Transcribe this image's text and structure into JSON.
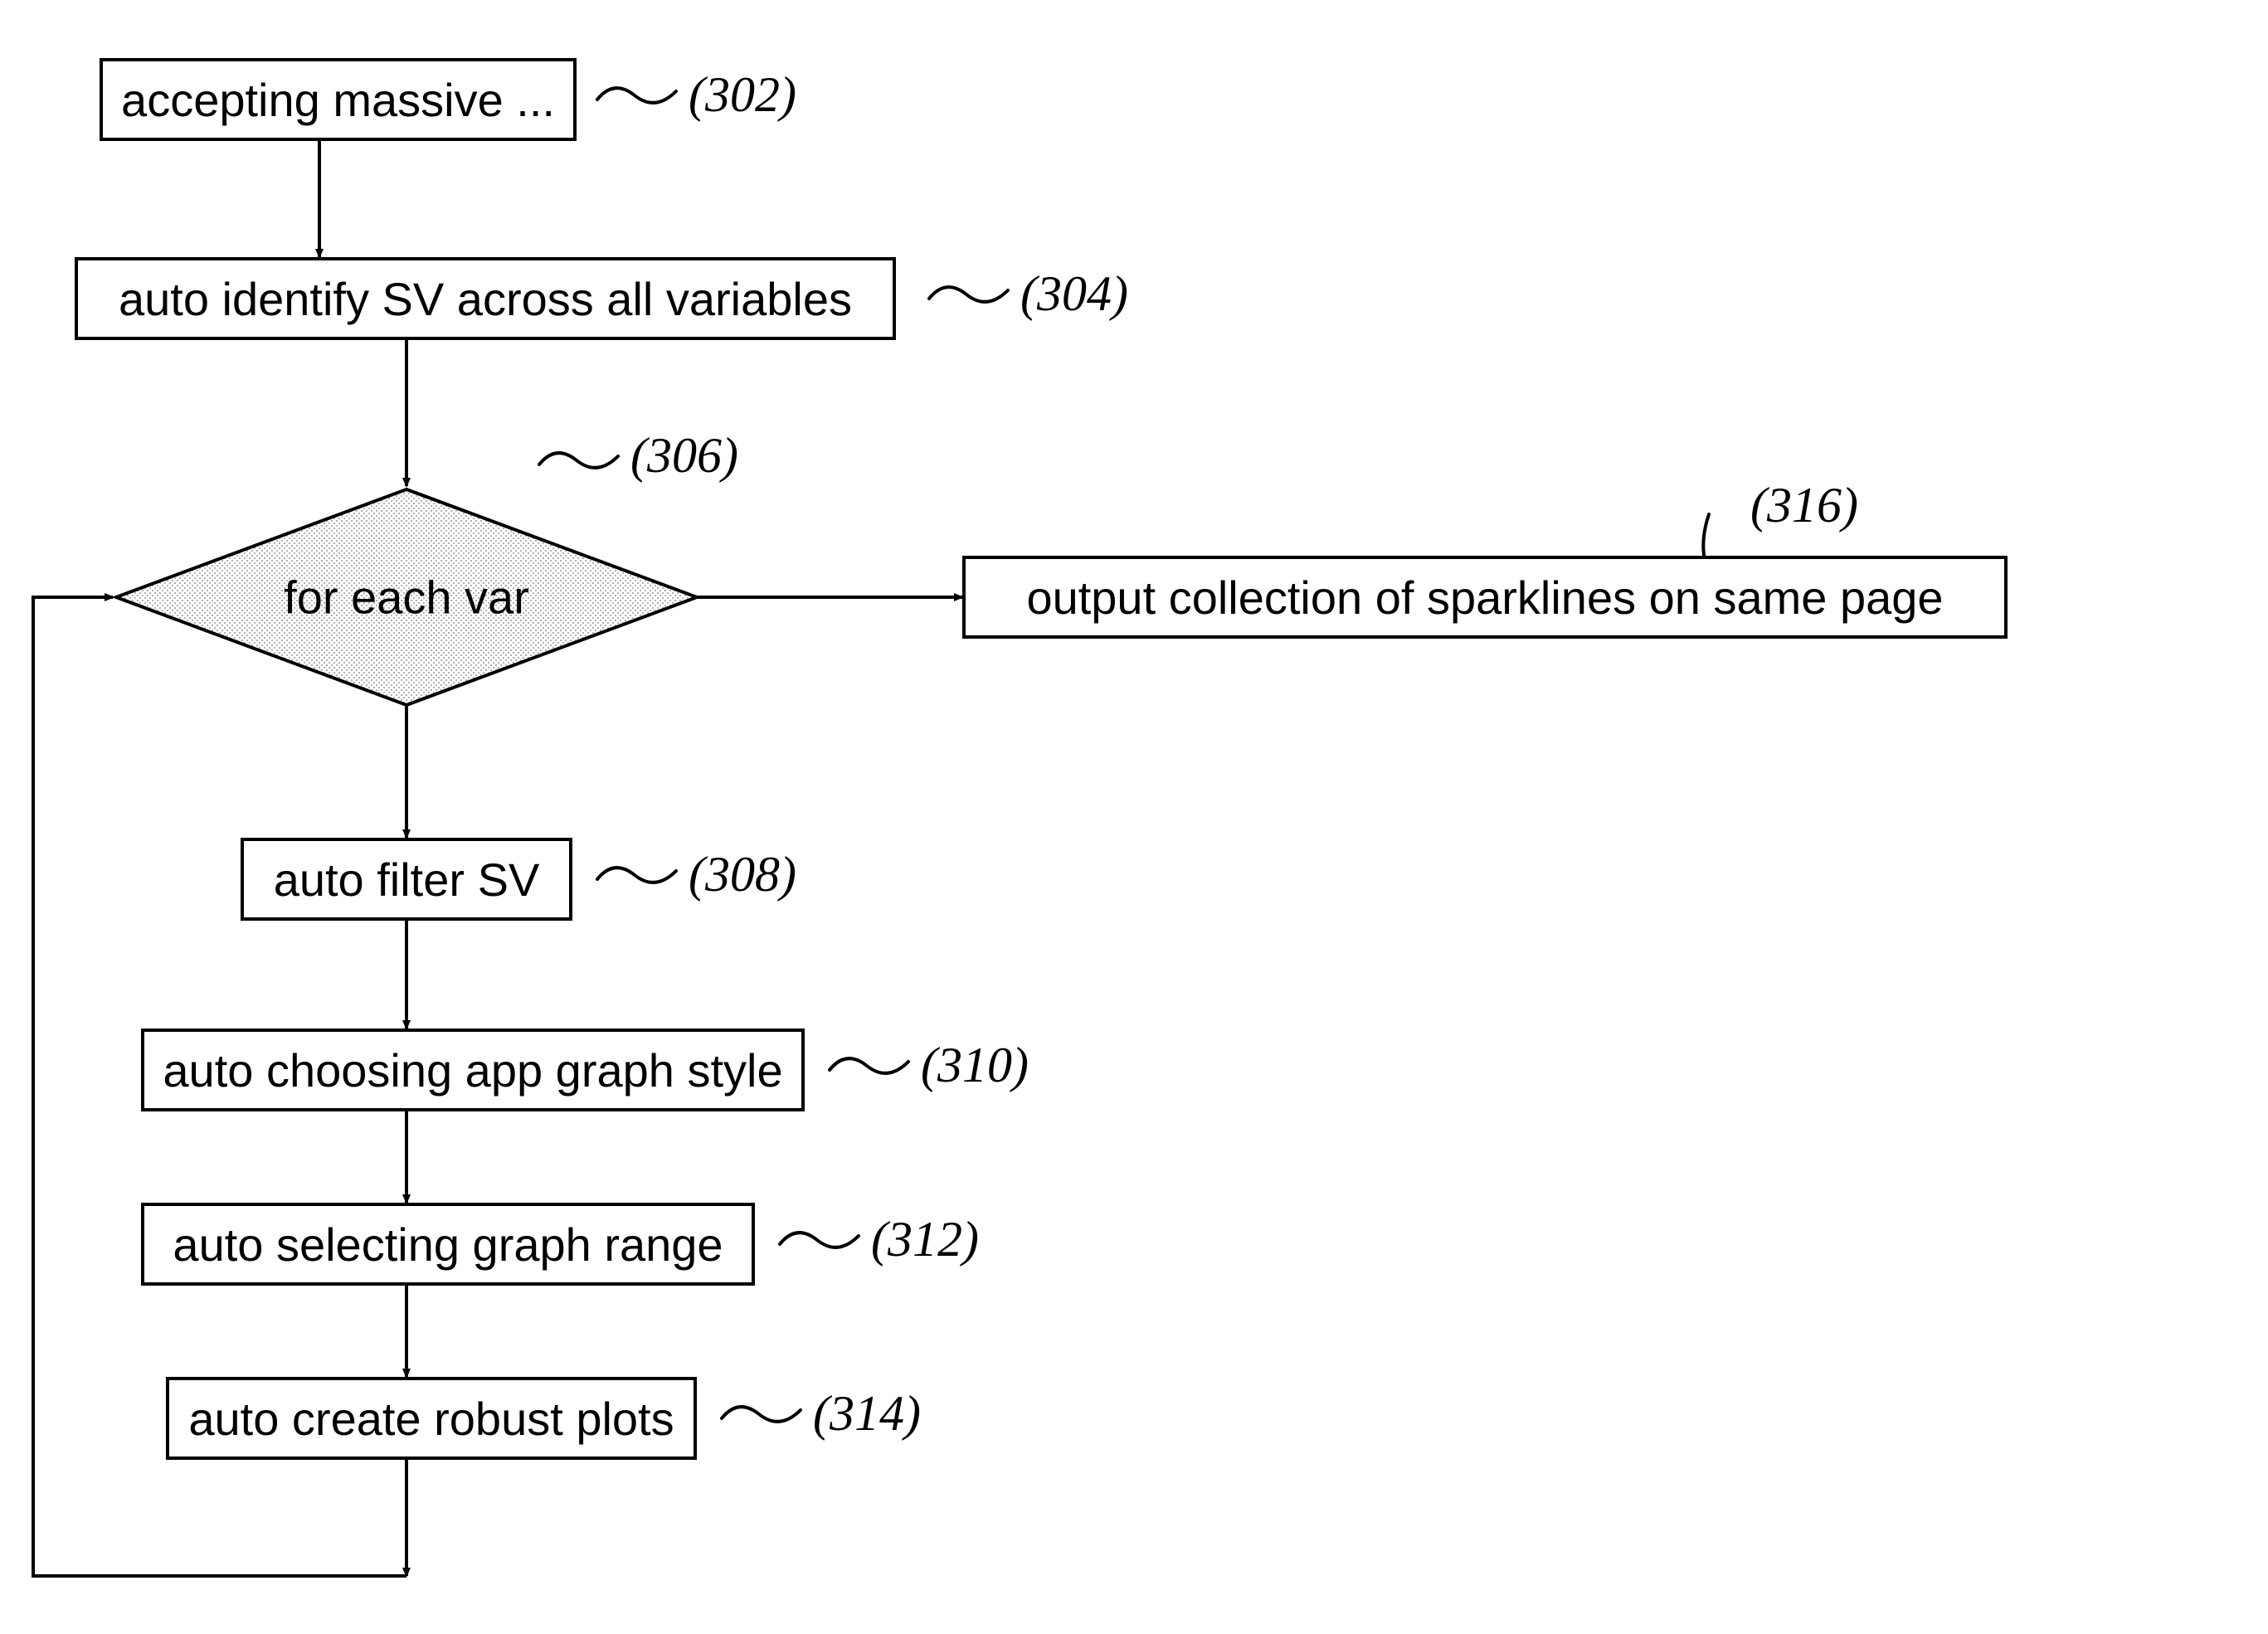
{
  "flowchart": {
    "nodes": {
      "n302": {
        "text": "accepting massive ...",
        "ref": "(302)"
      },
      "n304": {
        "text": "auto identify SV across all variables",
        "ref": "(304)"
      },
      "n306": {
        "text": "for each var",
        "ref": "(306)"
      },
      "n308": {
        "text": "auto filter SV",
        "ref": "(308)"
      },
      "n310": {
        "text": "auto choosing app graph style",
        "ref": "(310)"
      },
      "n312": {
        "text": "auto selecting graph range",
        "ref": "(312)"
      },
      "n314": {
        "text": "auto create robust plots",
        "ref": "(314)"
      },
      "n316": {
        "text": "output collection of sparklines on same page",
        "ref": "(316)"
      }
    },
    "tilde": "~"
  }
}
